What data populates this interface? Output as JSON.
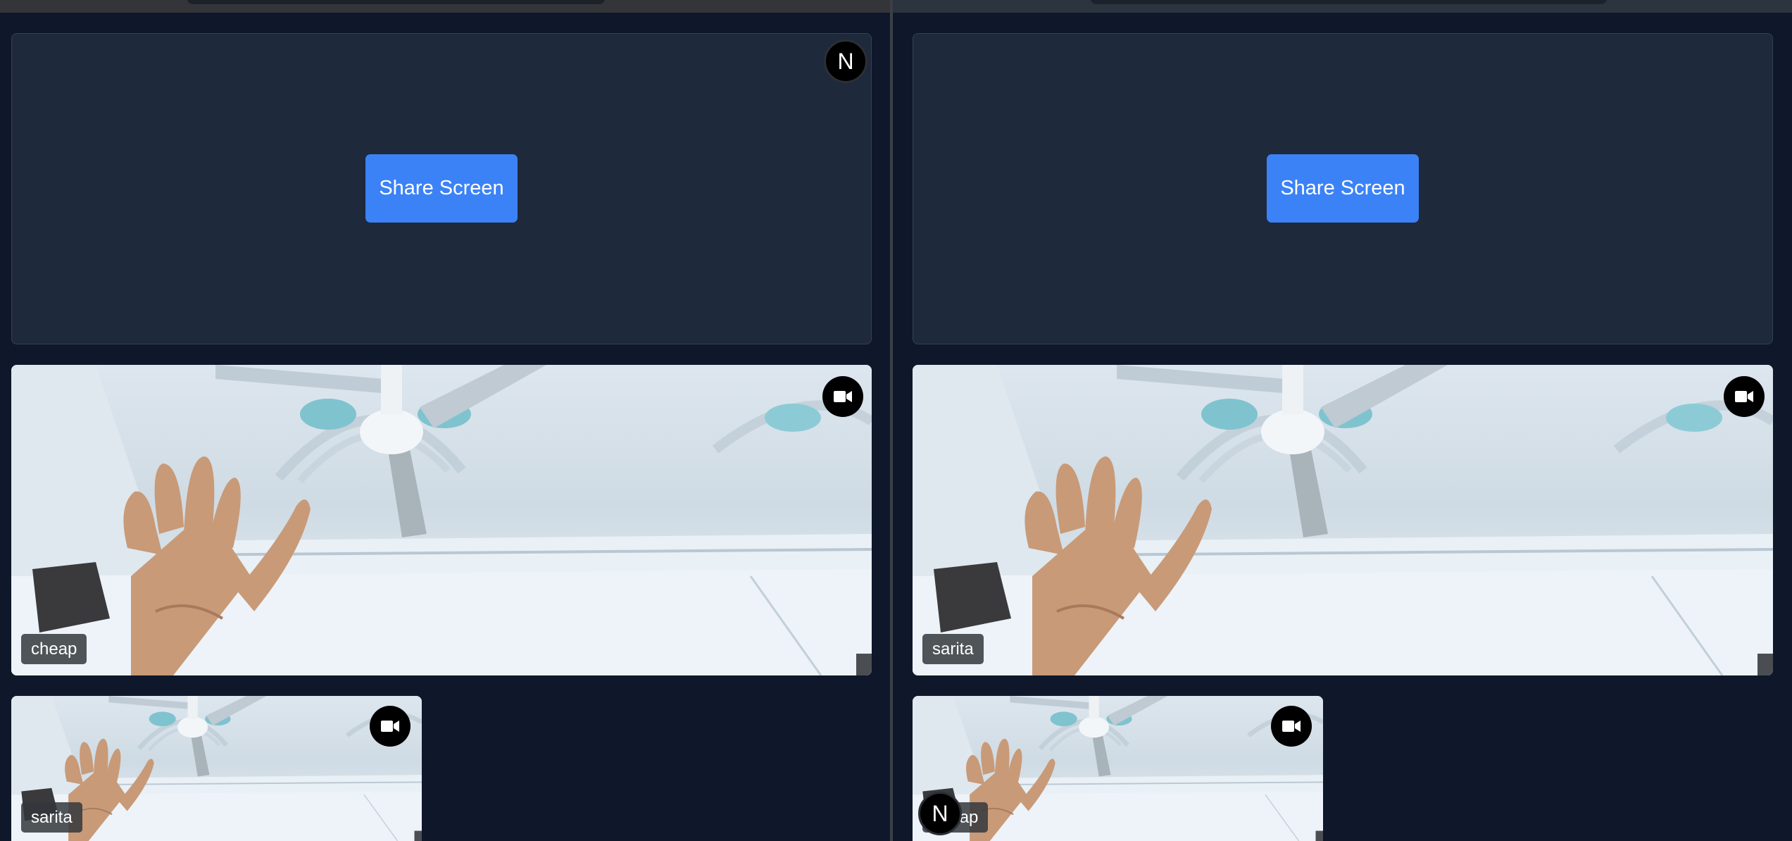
{
  "left_pane": {
    "share_button_label": "Share Screen",
    "avatar_letter": "N",
    "main_tile": {
      "name": "cheap",
      "camera_icon": "video-camera-icon"
    },
    "thumb_tile": {
      "name": "sarita",
      "camera_icon": "video-camera-icon"
    }
  },
  "right_pane": {
    "share_button_label": "Share Screen",
    "main_tile": {
      "name": "sarita",
      "camera_icon": "video-camera-icon"
    },
    "thumb_tile": {
      "name": "cheap",
      "camera_icon": "video-camera-icon"
    },
    "avatar_letter": "N"
  },
  "colors": {
    "background": "#0f172a",
    "panel": "#1e293b",
    "accent": "#3b82f6"
  }
}
